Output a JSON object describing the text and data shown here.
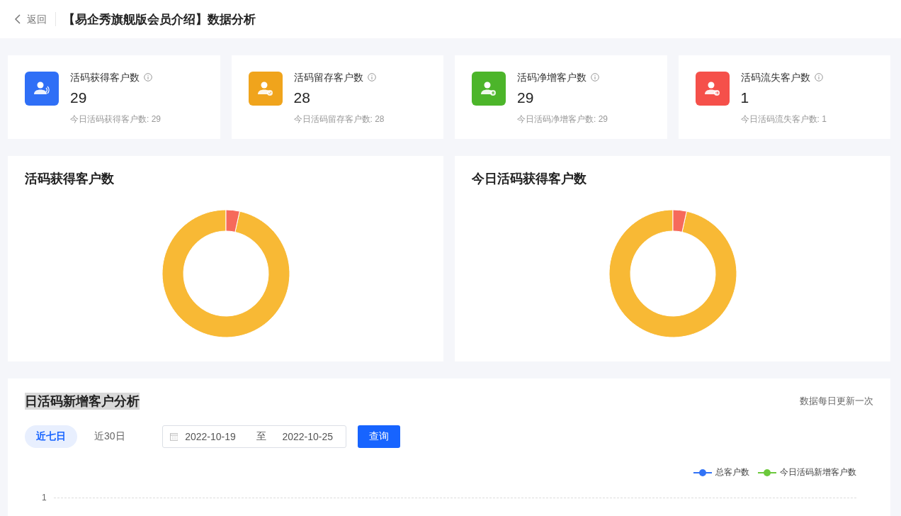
{
  "header": {
    "back_label": "返回",
    "title": "【易企秀旗舰版会员介绍】数据分析"
  },
  "stats": [
    {
      "kind": "signal",
      "color": "#2f6ff6",
      "label": "活码获得客户数",
      "value": "29",
      "today": "今日活码获得客户数: 29"
    },
    {
      "kind": "check",
      "color": "#f0a41c",
      "label": "活码留存客户数",
      "value": "28",
      "today": "今日活码留存客户数: 28"
    },
    {
      "kind": "plus",
      "color": "#4cb52a",
      "label": "活码净增客户数",
      "value": "29",
      "today": "今日活码净增客户数: 29"
    },
    {
      "kind": "arrow",
      "color": "#f5504a",
      "label": "活码流失客户数",
      "value": "1",
      "today": "今日活码流失客户数: 1"
    }
  ],
  "panels": [
    {
      "title": "活码获得客户数"
    },
    {
      "title": "今日活码获得客户数"
    }
  ],
  "analysis": {
    "title": "日活码新增客户分析",
    "highlighted": true,
    "note": "数据每日更新一次",
    "ranges": [
      {
        "label": "近七日",
        "selected": true
      },
      {
        "label": "近30日",
        "selected": false
      }
    ],
    "date_start": "2022-10-19",
    "separator": "至",
    "date_end": "2022-10-25",
    "query_button": "查询",
    "legend": [
      {
        "label": "总客户数",
        "color": "#3273f6"
      },
      {
        "label": "今日活码新增客户数",
        "color": "#6cc93c"
      }
    ],
    "y_tick": "1"
  }
}
